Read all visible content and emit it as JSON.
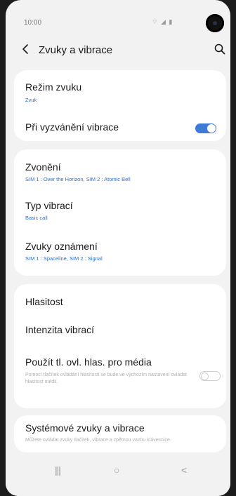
{
  "status": {
    "time": "10:00",
    "icons": "⌔ ◢ ▮"
  },
  "header": {
    "title": "Zvuky a vibrace"
  },
  "sections": {
    "sound_mode": {
      "title": "Režim zvuku",
      "value": "Zvuk"
    },
    "vibrate_when_ringing": {
      "title": "Při vyzvánění vibrace",
      "enabled": true
    },
    "ringtone": {
      "title": "Zvonění",
      "value": "SIM 1 : Over the Horizon, SIM 2 : Atomic Bell"
    },
    "vibration_pattern": {
      "title": "Typ vibrací",
      "value": "Basic call"
    },
    "notification_sounds": {
      "title": "Zvuky oznámení",
      "value": "SIM 1 : Spaceline, SIM 2 : Signal"
    },
    "volume": {
      "title": "Hlasitost"
    },
    "vibration_intensity": {
      "title": "Intenzita vibrací"
    },
    "media_volume_keys": {
      "title": "Použít tl. ovl. hlas. pro média",
      "description": "Pomocí tlačítek ovládání hlasitosti se bude ve výchozím nastavení ovládat hlasitost médií.",
      "enabled": false
    },
    "system_sounds": {
      "title": "Systémové zvuky a vibrace",
      "description": "Můžete ovládat zvuky tlačítek, vibrace a zpětnou vazbu klávesnice."
    }
  },
  "navbar": {
    "recents": "|||",
    "home": "○",
    "back": "<"
  },
  "colors": {
    "accent": "#3e7ad8",
    "background": "#f2f2f2",
    "card": "#ffffff"
  }
}
